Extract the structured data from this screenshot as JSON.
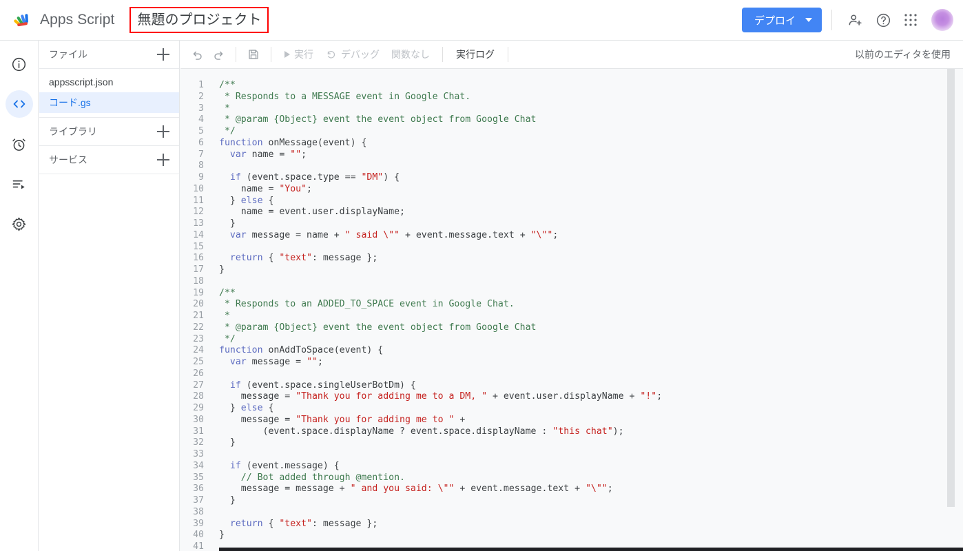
{
  "header": {
    "logo_icon": "apps-script-logo",
    "brand": "Apps Script",
    "project_title": "無題のプロジェクト",
    "deploy_label": "デプロイ",
    "deploy_caret_icon": "chevron-down-icon",
    "add_person_icon": "person-add-icon",
    "help_icon": "help-circle-icon",
    "apps_grid_icon": "apps-grid-icon",
    "avatar_icon": "user-avatar",
    "accent_color": "#4285f4",
    "annotation_color": "#fe0000"
  },
  "rail": {
    "items": [
      {
        "icon": "info-circle-icon",
        "name": "overview",
        "active": false
      },
      {
        "icon": "code-brackets-icon",
        "name": "editor",
        "active": true
      },
      {
        "icon": "alarm-clock-icon",
        "name": "triggers",
        "active": false
      },
      {
        "icon": "executions-list-icon",
        "name": "executions",
        "active": false
      },
      {
        "icon": "gear-icon",
        "name": "settings",
        "active": false
      }
    ]
  },
  "files_panel": {
    "files_header": "ファイル",
    "add_file_icon": "plus-icon",
    "files": [
      {
        "label": "appsscript.json",
        "selected": false
      },
      {
        "label": "コード.gs",
        "selected": true
      }
    ],
    "libraries_header": "ライブラリ",
    "add_library_icon": "plus-icon",
    "services_header": "サービス",
    "add_service_icon": "plus-icon"
  },
  "toolbar": {
    "undo_icon": "undo-icon",
    "redo_icon": "redo-icon",
    "save_icon": "save-floppy-icon",
    "run_label": "実行",
    "run_icon": "play-triangle-icon",
    "debug_label": "デバッグ",
    "debug_icon": "debug-icon",
    "function_select": "関数なし",
    "exec_log_label": "実行ログ",
    "legacy_editor_label": "以前のエディタを使用"
  },
  "editor": {
    "language": "javascript",
    "first_visible_line": 1,
    "last_visible_line": 41,
    "lines": [
      {
        "n": 1,
        "tokens": [
          {
            "t": "/**",
            "c": "com"
          }
        ]
      },
      {
        "n": 2,
        "tokens": [
          {
            "t": " * Responds to a MESSAGE event in Google Chat.",
            "c": "com"
          }
        ]
      },
      {
        "n": 3,
        "tokens": [
          {
            "t": " *",
            "c": "com"
          }
        ]
      },
      {
        "n": 4,
        "tokens": [
          {
            "t": " * @param {Object} event the event object from Google Chat",
            "c": "com"
          }
        ]
      },
      {
        "n": 5,
        "tokens": [
          {
            "t": " */",
            "c": "com"
          }
        ]
      },
      {
        "n": 6,
        "tokens": [
          {
            "t": "function",
            "c": "kw"
          },
          {
            "t": " onMessage(event) {",
            "c": ""
          }
        ]
      },
      {
        "n": 7,
        "tokens": [
          {
            "t": "  ",
            "c": ""
          },
          {
            "t": "var",
            "c": "kw"
          },
          {
            "t": " name = ",
            "c": ""
          },
          {
            "t": "\"\"",
            "c": "str"
          },
          {
            "t": ";",
            "c": ""
          }
        ]
      },
      {
        "n": 8,
        "tokens": [
          {
            "t": "",
            "c": ""
          }
        ]
      },
      {
        "n": 9,
        "tokens": [
          {
            "t": "  ",
            "c": ""
          },
          {
            "t": "if",
            "c": "kw"
          },
          {
            "t": " (event.space.type == ",
            "c": ""
          },
          {
            "t": "\"DM\"",
            "c": "str"
          },
          {
            "t": ") {",
            "c": ""
          }
        ]
      },
      {
        "n": 10,
        "tokens": [
          {
            "t": "    name = ",
            "c": ""
          },
          {
            "t": "\"You\"",
            "c": "str"
          },
          {
            "t": ";",
            "c": ""
          }
        ]
      },
      {
        "n": 11,
        "tokens": [
          {
            "t": "  } ",
            "c": ""
          },
          {
            "t": "else",
            "c": "kw"
          },
          {
            "t": " {",
            "c": ""
          }
        ]
      },
      {
        "n": 12,
        "tokens": [
          {
            "t": "    name = event.user.displayName;",
            "c": ""
          }
        ]
      },
      {
        "n": 13,
        "tokens": [
          {
            "t": "  }",
            "c": ""
          }
        ]
      },
      {
        "n": 14,
        "tokens": [
          {
            "t": "  ",
            "c": ""
          },
          {
            "t": "var",
            "c": "kw"
          },
          {
            "t": " message = name + ",
            "c": ""
          },
          {
            "t": "\" said \\\"\"",
            "c": "str"
          },
          {
            "t": " + event.message.text + ",
            "c": ""
          },
          {
            "t": "\"\\\"\"",
            "c": "str"
          },
          {
            "t": ";",
            "c": ""
          }
        ]
      },
      {
        "n": 15,
        "tokens": [
          {
            "t": "",
            "c": ""
          }
        ]
      },
      {
        "n": 16,
        "tokens": [
          {
            "t": "  ",
            "c": ""
          },
          {
            "t": "return",
            "c": "kw"
          },
          {
            "t": " { ",
            "c": ""
          },
          {
            "t": "\"text\"",
            "c": "str"
          },
          {
            "t": ": message };",
            "c": ""
          }
        ]
      },
      {
        "n": 17,
        "tokens": [
          {
            "t": "}",
            "c": ""
          }
        ]
      },
      {
        "n": 18,
        "tokens": [
          {
            "t": "",
            "c": ""
          }
        ]
      },
      {
        "n": 19,
        "tokens": [
          {
            "t": "/**",
            "c": "com"
          }
        ]
      },
      {
        "n": 20,
        "tokens": [
          {
            "t": " * Responds to an ADDED_TO_SPACE event in Google Chat.",
            "c": "com"
          }
        ]
      },
      {
        "n": 21,
        "tokens": [
          {
            "t": " *",
            "c": "com"
          }
        ]
      },
      {
        "n": 22,
        "tokens": [
          {
            "t": " * @param {Object} event the event object from Google Chat",
            "c": "com"
          }
        ]
      },
      {
        "n": 23,
        "tokens": [
          {
            "t": " */",
            "c": "com"
          }
        ]
      },
      {
        "n": 24,
        "tokens": [
          {
            "t": "function",
            "c": "kw"
          },
          {
            "t": " onAddToSpace(event) {",
            "c": ""
          }
        ]
      },
      {
        "n": 25,
        "tokens": [
          {
            "t": "  ",
            "c": ""
          },
          {
            "t": "var",
            "c": "kw"
          },
          {
            "t": " message = ",
            "c": ""
          },
          {
            "t": "\"\"",
            "c": "str"
          },
          {
            "t": ";",
            "c": ""
          }
        ]
      },
      {
        "n": 26,
        "tokens": [
          {
            "t": "",
            "c": ""
          }
        ]
      },
      {
        "n": 27,
        "tokens": [
          {
            "t": "  ",
            "c": ""
          },
          {
            "t": "if",
            "c": "kw"
          },
          {
            "t": " (event.space.singleUserBotDm) {",
            "c": ""
          }
        ]
      },
      {
        "n": 28,
        "tokens": [
          {
            "t": "    message = ",
            "c": ""
          },
          {
            "t": "\"Thank you for adding me to a DM, \"",
            "c": "str"
          },
          {
            "t": " + event.user.displayName + ",
            "c": ""
          },
          {
            "t": "\"!\"",
            "c": "str"
          },
          {
            "t": ";",
            "c": ""
          }
        ]
      },
      {
        "n": 29,
        "tokens": [
          {
            "t": "  } ",
            "c": ""
          },
          {
            "t": "else",
            "c": "kw"
          },
          {
            "t": " {",
            "c": ""
          }
        ]
      },
      {
        "n": 30,
        "tokens": [
          {
            "t": "    message = ",
            "c": ""
          },
          {
            "t": "\"Thank you for adding me to \"",
            "c": "str"
          },
          {
            "t": " +",
            "c": ""
          }
        ]
      },
      {
        "n": 31,
        "tokens": [
          {
            "t": "        (event.space.displayName ? event.space.displayName : ",
            "c": ""
          },
          {
            "t": "\"this chat\"",
            "c": "str"
          },
          {
            "t": ");",
            "c": ""
          }
        ]
      },
      {
        "n": 32,
        "tokens": [
          {
            "t": "  }",
            "c": ""
          }
        ]
      },
      {
        "n": 33,
        "tokens": [
          {
            "t": "",
            "c": ""
          }
        ]
      },
      {
        "n": 34,
        "tokens": [
          {
            "t": "  ",
            "c": ""
          },
          {
            "t": "if",
            "c": "kw"
          },
          {
            "t": " (event.message) {",
            "c": ""
          }
        ]
      },
      {
        "n": 35,
        "tokens": [
          {
            "t": "    // Bot added through @mention.",
            "c": "com"
          }
        ]
      },
      {
        "n": 36,
        "tokens": [
          {
            "t": "    message = message + ",
            "c": ""
          },
          {
            "t": "\" and you said: \\\"\"",
            "c": "str"
          },
          {
            "t": " + event.message.text + ",
            "c": ""
          },
          {
            "t": "\"\\\"\"",
            "c": "str"
          },
          {
            "t": ";",
            "c": ""
          }
        ]
      },
      {
        "n": 37,
        "tokens": [
          {
            "t": "  }",
            "c": ""
          }
        ]
      },
      {
        "n": 38,
        "tokens": [
          {
            "t": "",
            "c": ""
          }
        ]
      },
      {
        "n": 39,
        "tokens": [
          {
            "t": "  ",
            "c": ""
          },
          {
            "t": "return",
            "c": "kw"
          },
          {
            "t": " { ",
            "c": ""
          },
          {
            "t": "\"text\"",
            "c": "str"
          },
          {
            "t": ": message };",
            "c": ""
          }
        ]
      },
      {
        "n": 40,
        "tokens": [
          {
            "t": "}",
            "c": ""
          }
        ]
      },
      {
        "n": 41,
        "tokens": [
          {
            "t": "",
            "c": ""
          }
        ]
      }
    ]
  }
}
